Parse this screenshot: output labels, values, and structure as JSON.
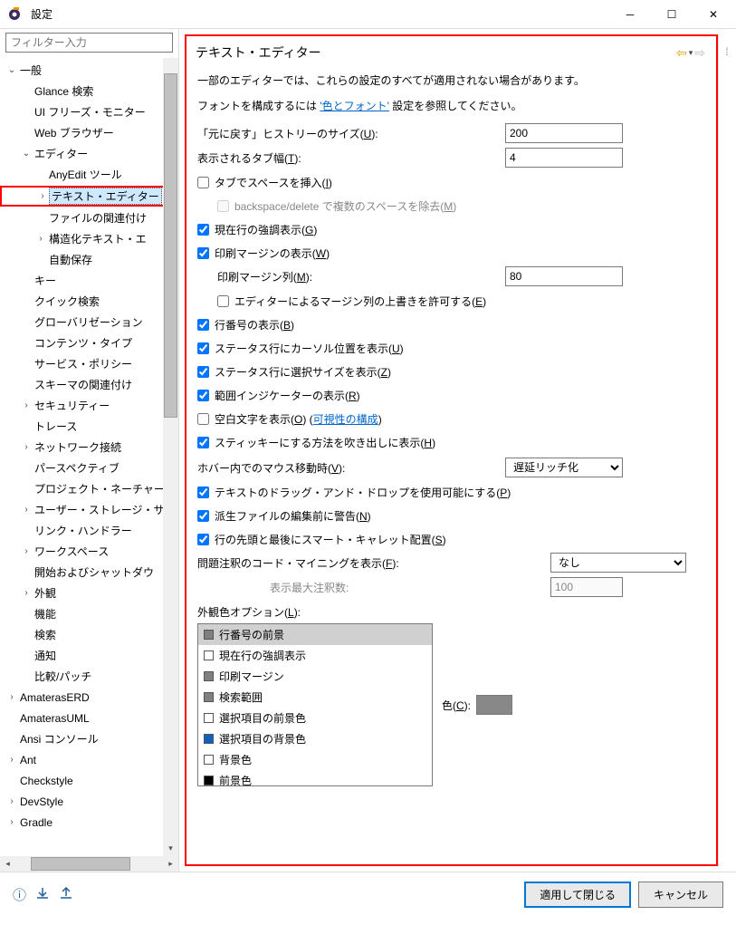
{
  "titlebar": {
    "title": "設定"
  },
  "sidebar": {
    "filter_placeholder": "フィルター入力",
    "items": [
      {
        "label": "一般",
        "exp": true,
        "depth": 0,
        "twisty": "v"
      },
      {
        "label": "Glance 検索",
        "depth": 1
      },
      {
        "label": "UI フリーズ・モニター",
        "depth": 1
      },
      {
        "label": "Web ブラウザー",
        "depth": 1
      },
      {
        "label": "エディター",
        "exp": true,
        "depth": 1,
        "twisty": "v"
      },
      {
        "label": "AnyEdit ツール",
        "depth": 2
      },
      {
        "label": "テキスト・エディター",
        "depth": 2,
        "twisty": ">",
        "selected": true
      },
      {
        "label": "ファイルの関連付け",
        "depth": 2
      },
      {
        "label": "構造化テキスト・エ",
        "depth": 2,
        "twisty": ">"
      },
      {
        "label": "自動保存",
        "depth": 2
      },
      {
        "label": "キー",
        "depth": 1
      },
      {
        "label": "クイック検索",
        "depth": 1
      },
      {
        "label": "グローバリゼーション",
        "depth": 1
      },
      {
        "label": "コンテンツ・タイプ",
        "depth": 1
      },
      {
        "label": "サービス・ポリシー",
        "depth": 1
      },
      {
        "label": "スキーマの関連付け",
        "depth": 1
      },
      {
        "label": "セキュリティー",
        "depth": 1,
        "twisty": ">"
      },
      {
        "label": "トレース",
        "depth": 1
      },
      {
        "label": "ネットワーク接続",
        "depth": 1,
        "twisty": ">"
      },
      {
        "label": "パースペクティブ",
        "depth": 1
      },
      {
        "label": "プロジェクト・ネーチャー",
        "depth": 1
      },
      {
        "label": "ユーザー・ストレージ・サ",
        "depth": 1,
        "twisty": ">"
      },
      {
        "label": "リンク・ハンドラー",
        "depth": 1
      },
      {
        "label": "ワークスペース",
        "depth": 1,
        "twisty": ">"
      },
      {
        "label": "開始およびシャットダウ",
        "depth": 1
      },
      {
        "label": "外観",
        "depth": 1,
        "twisty": ">"
      },
      {
        "label": "機能",
        "depth": 1
      },
      {
        "label": "検索",
        "depth": 1
      },
      {
        "label": "通知",
        "depth": 1
      },
      {
        "label": "比較/パッチ",
        "depth": 1
      },
      {
        "label": "AmaterasERD",
        "depth": 0,
        "twisty": ">"
      },
      {
        "label": "AmaterasUML",
        "depth": 0
      },
      {
        "label": "Ansi コンソール",
        "depth": 0
      },
      {
        "label": "Ant",
        "depth": 0,
        "twisty": ">"
      },
      {
        "label": "Checkstyle",
        "depth": 0
      },
      {
        "label": "DevStyle",
        "depth": 0,
        "twisty": ">"
      },
      {
        "label": "Gradle",
        "depth": 0,
        "twisty": ">"
      }
    ]
  },
  "page": {
    "heading": "テキスト・エディター",
    "desc1": "一部のエディターでは、これらの設定のすべてが適用されない場合があります。",
    "desc2_pre": "フォントを構成するには ",
    "desc2_link": "'色とフォント'",
    "desc2_post": " 設定を参照してください。",
    "undo_label_pre": "「元に戻す」ヒストリーのサイズ(",
    "undo_mnemonic": "U",
    "undo_label_post": "):",
    "undo_value": "200",
    "tabwidth_label_pre": "表示されるタブ幅(",
    "tabwidth_mnemonic": "T",
    "tabwidth_label_post": "):",
    "tabwidth_value": "4",
    "chk_spaces_for_tabs": "タブでスペースを挿入(",
    "chk_spaces_m": "I",
    "chk_bs_delete": "backspace/delete で複数のスペースを除去(",
    "chk_bs_m": "M",
    "chk_highlight_line": "現在行の強調表示(",
    "chk_highlight_m": "G",
    "chk_print_margin": "印刷マージンの表示(",
    "chk_print_m": "W",
    "print_col_label_pre": "印刷マージン列(",
    "print_col_m": "M",
    "print_col_label_post": "):",
    "print_col_value": "80",
    "chk_allow_override": "エディターによるマージン列の上書きを許可する(",
    "chk_allow_m": "E",
    "chk_line_numbers": "行番号の表示(",
    "chk_line_m": "B",
    "chk_cursor_pos": "ステータス行にカーソル位置を表示(",
    "chk_cursor_m": "U",
    "chk_sel_size": "ステータス行に選択サイズを表示(",
    "chk_sel_m": "Z",
    "chk_range": "範囲インジケーターの表示(",
    "chk_range_m": "R",
    "chk_whitespace": "空白文字を表示(",
    "chk_whitespace_m": "O",
    "chk_whitespace_post": ") (",
    "chk_whitespace_link": "可視性の構成",
    "chk_sticky": "スティッキーにする方法を吹き出しに表示(",
    "chk_sticky_m": "H",
    "hover_label_pre": "ホバー内でのマウス移動時(",
    "hover_m": "V",
    "hover_label_post": "):",
    "hover_value": "遅延リッチ化",
    "chk_dnd": "テキストのドラッグ・アンド・ドロップを使用可能にする(",
    "chk_dnd_m": "P",
    "chk_derived": "派生ファイルの編集前に警告(",
    "chk_derived_m": "N",
    "chk_smart_caret": "行の先頭と最後にスマート・キャレット配置(",
    "chk_smart_m": "S",
    "code_mining_label_pre": "問題注釈のコード・マイニングを表示(",
    "code_mining_m": "F",
    "code_mining_label_post": "):",
    "code_mining_value": "なし",
    "max_annot_label": "表示最大注釈数:",
    "max_annot_value": "100",
    "appearance_label_pre": "外観色オプション(",
    "appearance_m": "L",
    "appearance_label_post": "):",
    "color_label_pre": "色(",
    "color_m": "C",
    "color_label_post": "):",
    "list_items": [
      {
        "label": "行番号の前景",
        "color": "#808080",
        "sel": true
      },
      {
        "label": "現在行の強調表示",
        "color": "#ffffff"
      },
      {
        "label": "印刷マージン",
        "color": "#808080"
      },
      {
        "label": "検索範囲",
        "color": "#808080"
      },
      {
        "label": "選択項目の前景色",
        "color": "#ffffff"
      },
      {
        "label": "選択項目の背景色",
        "color": "#1060c0"
      },
      {
        "label": "背景色",
        "color": "#ffffff"
      },
      {
        "label": "前景色",
        "color": "#000000"
      }
    ]
  },
  "footer": {
    "apply_close": "適用して閉じる",
    "cancel": "キャンセル"
  }
}
